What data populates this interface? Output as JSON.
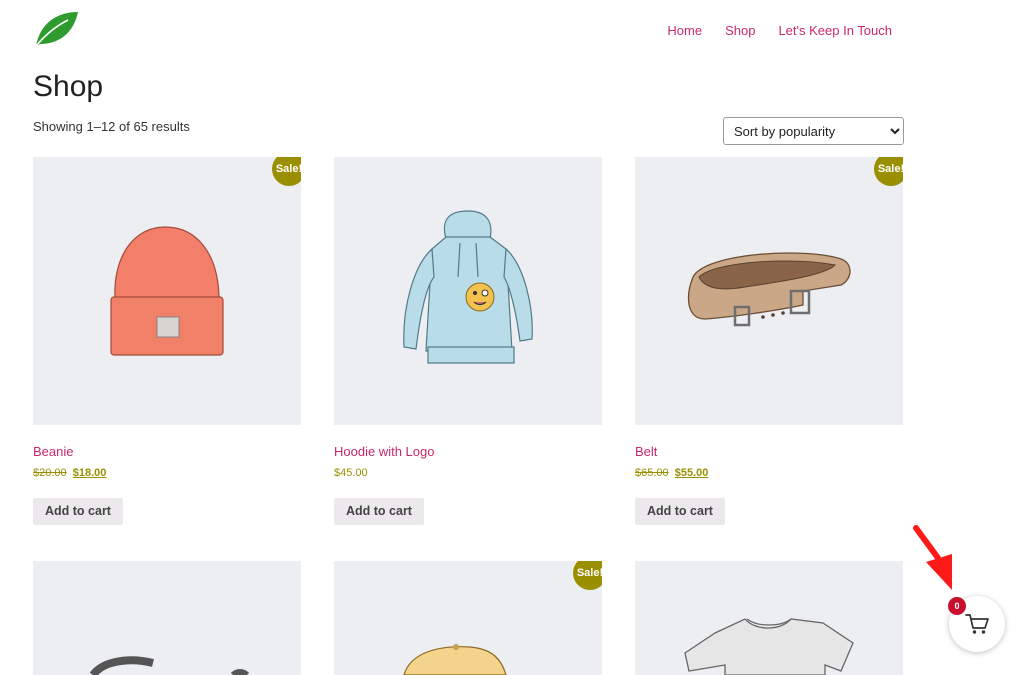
{
  "nav": {
    "items": [
      "Home",
      "Shop",
      "Let's Keep In Touch"
    ]
  },
  "page": {
    "title": "Shop",
    "result_count": "Showing 1–12 of 65 results",
    "sort": {
      "selected": "Sort by popularity"
    }
  },
  "products": [
    {
      "name": "Beanie",
      "price_old": "$20.00",
      "price_new": "$18.00",
      "badge": "Sale!",
      "button": "Add to cart"
    },
    {
      "name": "Hoodie with Logo",
      "price": "$45.00",
      "button": "Add to cart"
    },
    {
      "name": "Belt",
      "price_old": "$65.00",
      "price_new": "$55.00",
      "badge": "Sale!",
      "button": "Add to cart"
    }
  ],
  "row2": [
    {
      "badge": ""
    },
    {
      "badge": "Sale!"
    },
    {
      "badge": ""
    }
  ],
  "cart": {
    "count": "0",
    "icon": "cart-icon"
  },
  "colors": {
    "accent": "#c9286c",
    "sale": "#9a8f00",
    "cart_badge": "#c8102e",
    "product_bg": "#eceef2"
  }
}
